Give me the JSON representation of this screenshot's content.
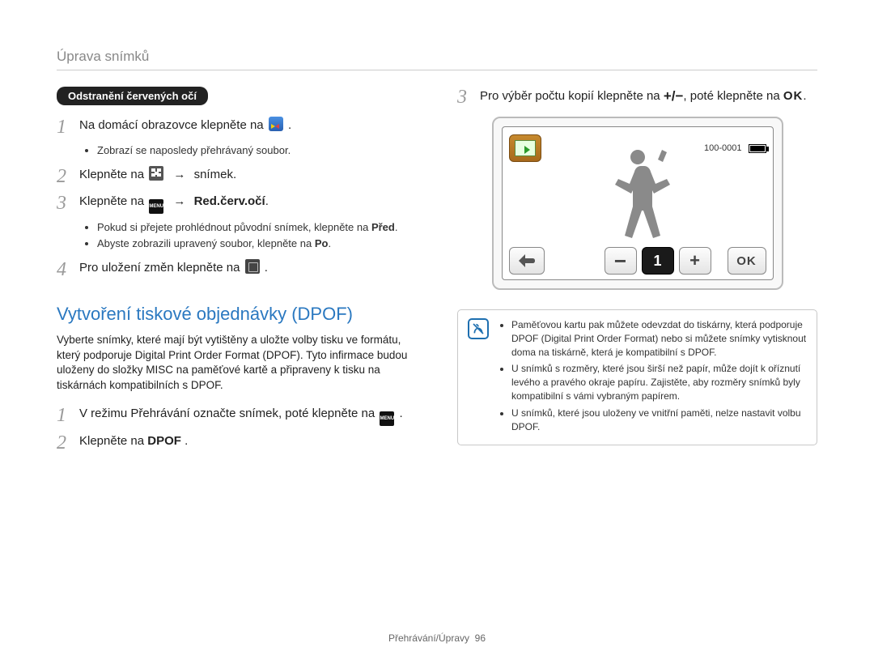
{
  "header": {
    "title": "Úprava snímků"
  },
  "left": {
    "pill": "Odstranění červených očí",
    "step1": {
      "num": "1",
      "text_a": "Na domácí obrazovce klepněte na ",
      "text_b": "."
    },
    "step1_bullet": "Zobrazí se naposledy přehrávaný soubor.",
    "step2": {
      "num": "2",
      "text_a": "Klepněte na ",
      "text_arrow": "→",
      "text_b": " snímek."
    },
    "step3": {
      "num": "3",
      "text_a": "Klepněte na ",
      "text_arrow": "→",
      "text_b": "Red.červ.očí",
      "text_c": "."
    },
    "step3_b1_a": "Pokud si přejete prohlédnout původní snímek, klepněte na ",
    "step3_b1_bold": "Před",
    "step3_b1_c": ".",
    "step3_b2_a": "Abyste zobrazili upravený soubor, klepněte na ",
    "step3_b2_bold": "Po",
    "step3_b2_c": ".",
    "step4": {
      "num": "4",
      "text_a": "Pro uložení změn klepněte na ",
      "text_b": "."
    },
    "section_title": "Vytvoření tiskové objednávky (DPOF)",
    "section_para": "Vyberte snímky, které mají být vytištěny a uložte volby tisku ve formátu, který podporuje Digital Print Order Format (DPOF). Tyto infirmace budou uloženy do složky MISC na paměťové kartě a připraveny k tisku na tiskárnách kompatibilních s DPOF.",
    "d_step1": {
      "num": "1",
      "text_a": "V režimu Přehrávání označte snímek, poté klepněte na ",
      "text_b": "."
    },
    "d_step2": {
      "num": "2",
      "text_a": "Klepněte na ",
      "text_bold": "DPOF",
      "text_b": "."
    }
  },
  "right": {
    "step3": {
      "num": "3",
      "text_a": "Pro výběr počtu kopií klepněte na ",
      "plusminus": "+/−",
      "text_b": ", poté klepněte na ",
      "ok": "OK",
      "text_c": "."
    },
    "lcd": {
      "file_no": "100-0001",
      "count": "1",
      "ok": "OK"
    },
    "note": {
      "b1": "Paměťovou kartu pak můžete odevzdat do tiskárny, která podporuje DPOF (Digital Print Order Format) nebo si můžete snímky vytisknout doma na tiskárně, která je kompatibilní s DPOF.",
      "b2": "U snímků s rozměry, které jsou širší než papír, může dojít k oříznutí levého a pravého okraje papíru. Zajistěte, aby rozměry snímků byly kompatibilní s vámi vybraným papírem.",
      "b3": "U snímků, které jsou uloženy ve vnitřní paměti, nelze nastavit volbu DPOF."
    }
  },
  "footer": {
    "section": "Přehrávání/Úpravy",
    "page": "96"
  }
}
